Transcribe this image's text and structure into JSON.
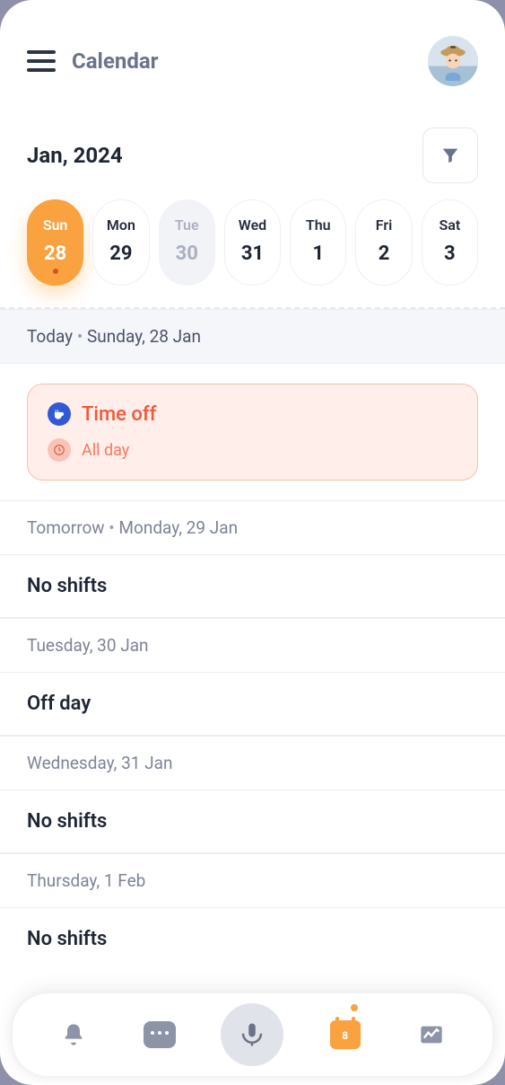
{
  "header": {
    "title": "Calendar"
  },
  "month": {
    "label": "Jan, 2024"
  },
  "days": [
    {
      "dow": "Sun",
      "num": "28",
      "state": "active"
    },
    {
      "dow": "Mon",
      "num": "29",
      "state": ""
    },
    {
      "dow": "Tue",
      "num": "30",
      "state": "muted"
    },
    {
      "dow": "Wed",
      "num": "31",
      "state": ""
    },
    {
      "dow": "Thu",
      "num": "1",
      "state": ""
    },
    {
      "dow": "Fri",
      "num": "2",
      "state": ""
    },
    {
      "dow": "Sat",
      "num": "3",
      "state": ""
    }
  ],
  "sections": {
    "today_prefix": "Today",
    "today_date": "Sunday, 28 Jan",
    "tomorrow_prefix": "Tomorrow",
    "tomorrow_date": "Monday, 29 Jan",
    "tue_date": "Tuesday, 30 Jan",
    "wed_date": "Wednesday, 31 Jan",
    "thu_date": "Thursday, 1 Feb"
  },
  "event": {
    "title": "Time off",
    "subtitle": "All day"
  },
  "rows": {
    "no_shifts": "No shifts",
    "off_day": "Off day"
  },
  "nav": {
    "cal_badge": "8"
  }
}
